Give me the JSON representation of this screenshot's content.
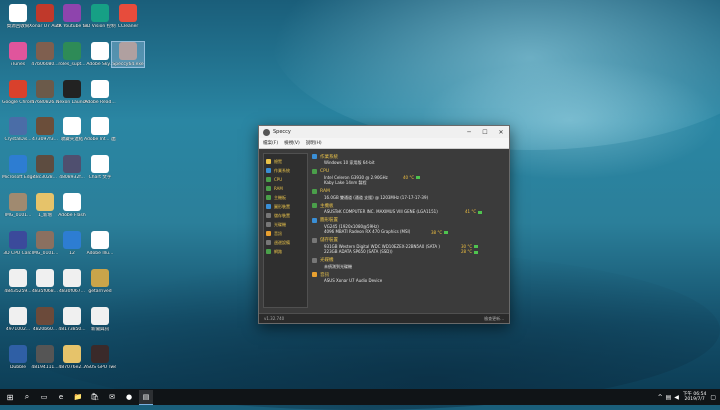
{
  "desktop": {
    "icons": [
      {
        "label": "資源回收筒",
        "color": "#ffffff"
      },
      {
        "label": "Xonar U7 Audio ...",
        "color": "#c0392b"
      },
      {
        "label": "4K Youtube to MP3",
        "color": "#8e44ad"
      },
      {
        "label": "3D Vision 控制台",
        "color": "#16a085"
      },
      {
        "label": "CCleaner",
        "color": "#e74c3c"
      },
      {
        "label": "iTunes",
        "color": "#e0559c"
      },
      {
        "label": "47b06080...",
        "color": "#7f5f4f"
      },
      {
        "label": "roles_supt...",
        "color": "#2e8b57"
      },
      {
        "label": "Adobe Sky...",
        "color": "#ffffff"
      },
      {
        "label": "Speccy64.exe",
        "color": "#b0a0a0"
      },
      {
        "label": "Google Chrome",
        "color": "#d9412c"
      },
      {
        "label": "47680826...",
        "color": "#6b5a4a"
      },
      {
        "label": "Nexon Launcher",
        "color": "#222222"
      },
      {
        "label": "Adobe Read...",
        "color": "#ffffff"
      },
      {
        "label": "CrystalDis...",
        "color": "#4a6da7"
      },
      {
        "label": "473097f3...",
        "color": "#6b4e3a"
      },
      {
        "label": "收藏夾連結",
        "color": "#ffffff"
      },
      {
        "label": "Adobe Inf... 連結",
        "color": "#ffffff"
      },
      {
        "label": "Microsoft Edge",
        "color": "#2d7dd2"
      },
      {
        "label": "48c3028...",
        "color": "#5d4c40"
      },
      {
        "label": "4808932f...",
        "color": "#4f4f6f"
      },
      {
        "label": "Chart 文字",
        "color": "#ffffff"
      },
      {
        "label": "IMG_0101...",
        "color": "#a08a70"
      },
      {
        "label": "1_新增",
        "color": "#e6c36a"
      },
      {
        "label": "Adobe Flash",
        "color": "#ffffff"
      },
      {
        "label": "3D CPU Calc.",
        "color": "#3b4a9b"
      },
      {
        "label": "IMG_0101...",
        "color": "#8a7060"
      },
      {
        "label": "12",
        "color": "#2d7dd2"
      },
      {
        "label": "Adobe Illu...",
        "color": "#ffffff"
      },
      {
        "label": "48435259...",
        "color": "#f0f0f0"
      },
      {
        "label": "4835f068...",
        "color": "#f0f0f0"
      },
      {
        "label": "4830f067...",
        "color": "#f0f0f0"
      },
      {
        "label": "getarrived",
        "color": "#c9a44a"
      },
      {
        "label": "4971002...",
        "color": "#f0f0f0"
      },
      {
        "label": "4820b60...",
        "color": "#6b4a3a"
      },
      {
        "label": "48173850...",
        "color": "#f0f0f0"
      },
      {
        "label": "新聞與訊",
        "color": "#f0f0f0"
      },
      {
        "label": "Dubble",
        "color": "#2f5fa5"
      },
      {
        "label": "48194111...",
        "color": "#555555"
      },
      {
        "label": "487076e2...",
        "color": "#e6c36a"
      },
      {
        "label": "ASUS GPU Tweak II",
        "color": "#3a2a2a"
      }
    ]
  },
  "window": {
    "title": "Speccy",
    "menu": [
      "檔案(F)",
      "檢視(V)",
      "說明(H)"
    ],
    "sidebar": [
      {
        "label": "總覽",
        "color": "#e8c24a"
      },
      {
        "label": "作業系統",
        "color": "#3a8fd6"
      },
      {
        "label": "CPU",
        "color": "#4a9f4a"
      },
      {
        "label": "RAM",
        "color": "#4a9f4a"
      },
      {
        "label": "主機板",
        "color": "#4a9f4a"
      },
      {
        "label": "圖形裝置",
        "color": "#3a8fd6"
      },
      {
        "label": "儲存裝置",
        "color": "#777777"
      },
      {
        "label": "光碟機",
        "color": "#777777"
      },
      {
        "label": "音訊",
        "color": "#e8a030"
      },
      {
        "label": "週邊設備",
        "color": "#777777"
      },
      {
        "label": "網路",
        "color": "#4a9f4a"
      }
    ],
    "sections": [
      {
        "header": "作業系統",
        "color": "#3a8fd6",
        "lines": [
          "Windows 10 家用版 64-bit"
        ]
      },
      {
        "header": "CPU",
        "color": "#4a9f4a",
        "lines": [
          "Intel Celeron G3930 @ 2.90GHz",
          "Kaby Lake 14nm 製程"
        ],
        "temp": "40 °C"
      },
      {
        "header": "RAM",
        "color": "#4a9f4a",
        "lines": [
          "16.0GB 雙通道 (通道 支援) @ 1203MHz (17-17-17-39)"
        ]
      },
      {
        "header": "主機板",
        "color": "#4a9f4a",
        "lines": [
          "ASUSTeK COMPUTER INC. MAXIMUS VIII GENE (LGA1151)"
        ],
        "temp": "41 °C"
      },
      {
        "header": "圖形裝置",
        "color": "#3a8fd6",
        "lines": [
          "VG245 (1920x1080@59Hz)",
          "4096 MBATI Radeon RX 470 Graphics (MSI)"
        ],
        "temp": "38 °C"
      },
      {
        "header": "儲存裝置",
        "color": "#777777",
        "lines": [
          "931GB Western Digital WDC WD10EZEX-22BN5A0 (SATA )",
          "223GB ADATA SP650 (SATA (SSD))"
        ],
        "temps": [
          "30 °C",
          "28 °C"
        ]
      },
      {
        "header": "光碟機",
        "color": "#777777",
        "lines": [
          "未偵測到光碟機"
        ]
      },
      {
        "header": "音訊",
        "color": "#e8a030",
        "lines": [
          "ASUS Xonar U7 Audio Device"
        ]
      }
    ],
    "status_left": "v1.32.740",
    "status_right": "檢查更新..."
  },
  "taskbar": {
    "start": "⊞",
    "search": "⌕",
    "apps": [
      "▭",
      "e",
      "📁",
      "🛍",
      "✉",
      "●",
      "▤"
    ],
    "time": "下午 06:54",
    "date": "2019/7/7"
  }
}
